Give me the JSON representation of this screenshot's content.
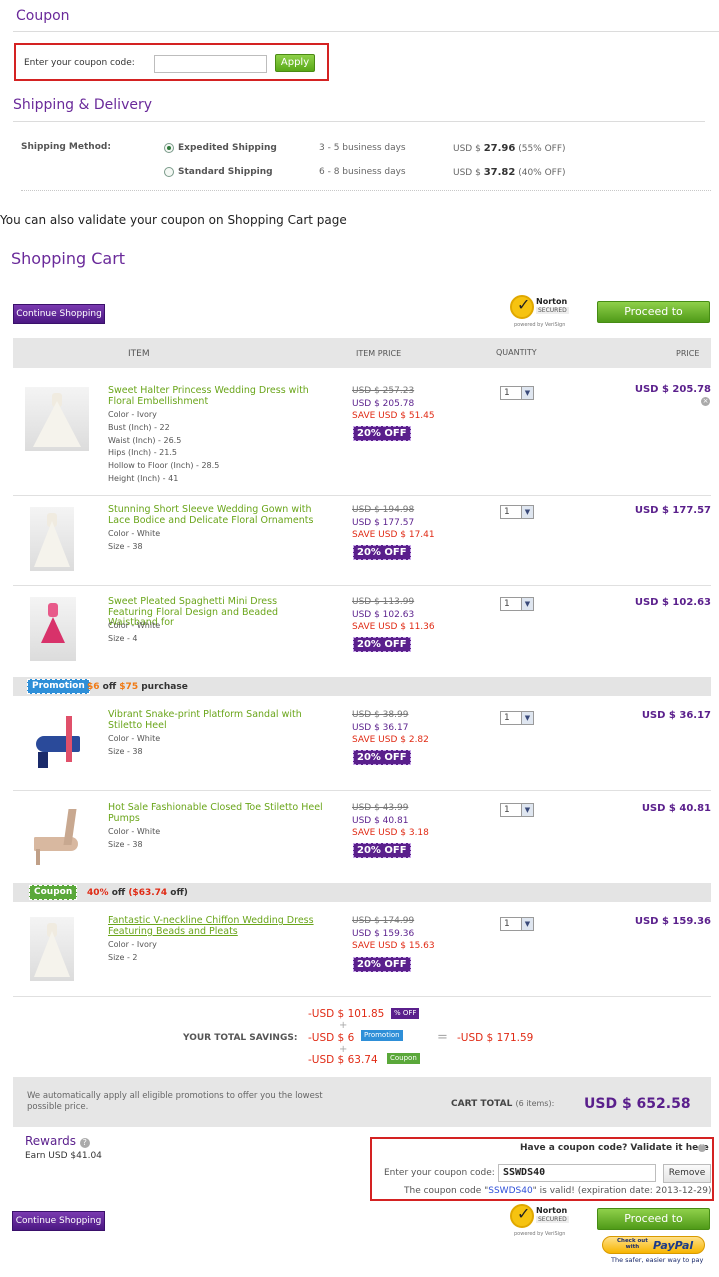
{
  "coupon_section": {
    "title": "Coupon",
    "label": "Enter your coupon code:",
    "input_value": "",
    "apply_label": "Apply"
  },
  "shipping": {
    "title": "Shipping & Delivery",
    "method_label": "Shipping Method:",
    "options": [
      {
        "name": "Expedited Shipping",
        "days": "3 - 5 business days",
        "price_prefix": "USD $",
        "price": "27.96",
        "discount": "(55% OFF)",
        "selected": true
      },
      {
        "name": "Standard Shipping",
        "days": "6 - 8 business days",
        "price_prefix": "USD $",
        "price": "37.82",
        "discount": "(40% OFF)",
        "selected": false
      }
    ]
  },
  "note": "You can also validate your coupon on Shopping Cart page",
  "cart": {
    "title": "Shopping Cart",
    "continue_label": "Continue Shopping",
    "checkout_label": "Proceed to Checkout",
    "norton": {
      "name": "Norton",
      "secured": "SECURED",
      "verisign": "powered by VeriSign"
    },
    "headers": {
      "item": "ITEM",
      "item_price": "ITEM PRICE",
      "quantity": "QUANTITY",
      "price": "PRICE"
    },
    "items": [
      {
        "name": "Sweet Halter Princess Wedding Dress with Floral Embellishment",
        "attrs": [
          "Color - Ivory",
          "Bust (Inch) - 22",
          "Waist (Inch) - 26.5",
          "Hips (Inch) - 21.5",
          "Hollow to Floor (Inch) - 28.5",
          "Height (Inch) - 41"
        ],
        "old": "USD $ 257.23",
        "new": "USD $ 205.78",
        "save": "SAVE USD $ 51.45",
        "off": "20% OFF",
        "qty": "1",
        "price": "USD $ 205.78"
      },
      {
        "name": "Stunning Short Sleeve Wedding Gown with Lace Bodice and Delicate Floral Ornaments",
        "attrs": [
          "Color - White",
          "Size - 38"
        ],
        "old": "USD $ 194.98",
        "new": "USD $ 177.57",
        "save": "SAVE USD $ 17.41",
        "off": "20% OFF",
        "qty": "1",
        "price": "USD $ 177.57"
      },
      {
        "name": "Sweet Pleated Spaghetti Mini Dress Featuring Floral Design and Beaded Waistband for",
        "attrs": [
          "Color - White",
          "Size - 4"
        ],
        "old": "USD $ 113.99",
        "new": "USD $ 102.63",
        "save": "SAVE USD $ 11.36",
        "off": "20% OFF",
        "qty": "1",
        "price": "USD $ 102.63"
      },
      {
        "name": "Vibrant Snake-print Platform Sandal with Stiletto Heel",
        "attrs": [
          "Color - White",
          "Size - 38"
        ],
        "old": "USD $ 38.99",
        "new": "USD $ 36.17",
        "save": "SAVE USD $ 2.82",
        "off": "20% OFF",
        "qty": "1",
        "price": "USD $ 36.17"
      },
      {
        "name": "Hot Sale Fashionable Closed Toe Stiletto Heel Pumps",
        "attrs": [
          "Color - White",
          "Size - 38"
        ],
        "old": "USD $ 43.99",
        "new": "USD $ 40.81",
        "save": "SAVE USD $ 3.18",
        "off": "20% OFF",
        "qty": "1",
        "price": "USD $ 40.81"
      },
      {
        "name": "Fantastic V-neckline Chiffon Wedding Dress Featuring Beads and Pleats",
        "attrs": [
          "Color - Ivory",
          "Size - 2"
        ],
        "old": "USD $ 174.99",
        "new": "USD $ 159.36",
        "save": "SAVE USD $ 15.63",
        "off": "20% OFF",
        "qty": "1",
        "price": "USD $ 159.36"
      }
    ],
    "promotion_bar": {
      "tag": "Promotion",
      "amount": "$6",
      "off": "off",
      "threshold": "$75",
      "suffix": "purchase"
    },
    "coupon_bar": {
      "tag": "Coupon",
      "percent": "40%",
      "off": "off",
      "saved": "($63.74",
      "saved_suffix": "off)"
    },
    "savings": {
      "label": "YOUR TOTAL SAVINGS:",
      "lines": [
        "-USD $ 101.85",
        "-USD $ 6",
        "-USD $ 63.74"
      ],
      "badges": [
        "% OFF",
        "Promotion",
        "Coupon"
      ],
      "plus": "+",
      "equals": "=",
      "total": "-USD $ 171.59"
    },
    "summary": {
      "note": "We automatically apply all eligible promotions to offer you the lowest possible price.",
      "total_label": "CART TOTAL",
      "items_count": "(6 items):",
      "total": "USD $ 652.58"
    },
    "rewards": {
      "title": "Rewards",
      "help": "?",
      "earn": "Earn USD $41.04"
    },
    "validate": {
      "title": "Have a coupon code? Validate it here",
      "label": "Enter your coupon code:",
      "input_value": "SSWDS40",
      "remove_label": "Remove",
      "msg_prefix": "The coupon code \"",
      "msg_code": "SSWDS40",
      "msg_suffix": "\" is valid! (expiration date: 2013-12-29)"
    },
    "paypal": {
      "check": "Check out",
      "with": "with",
      "brand": "PayPal",
      "tagline": "The safer, easier way to pay"
    }
  },
  "colors": {
    "brand_purple": "#5a1f8c",
    "accent_green": "#6aa51a",
    "sale_red": "#e02a14",
    "alert_red": "#d42222"
  }
}
